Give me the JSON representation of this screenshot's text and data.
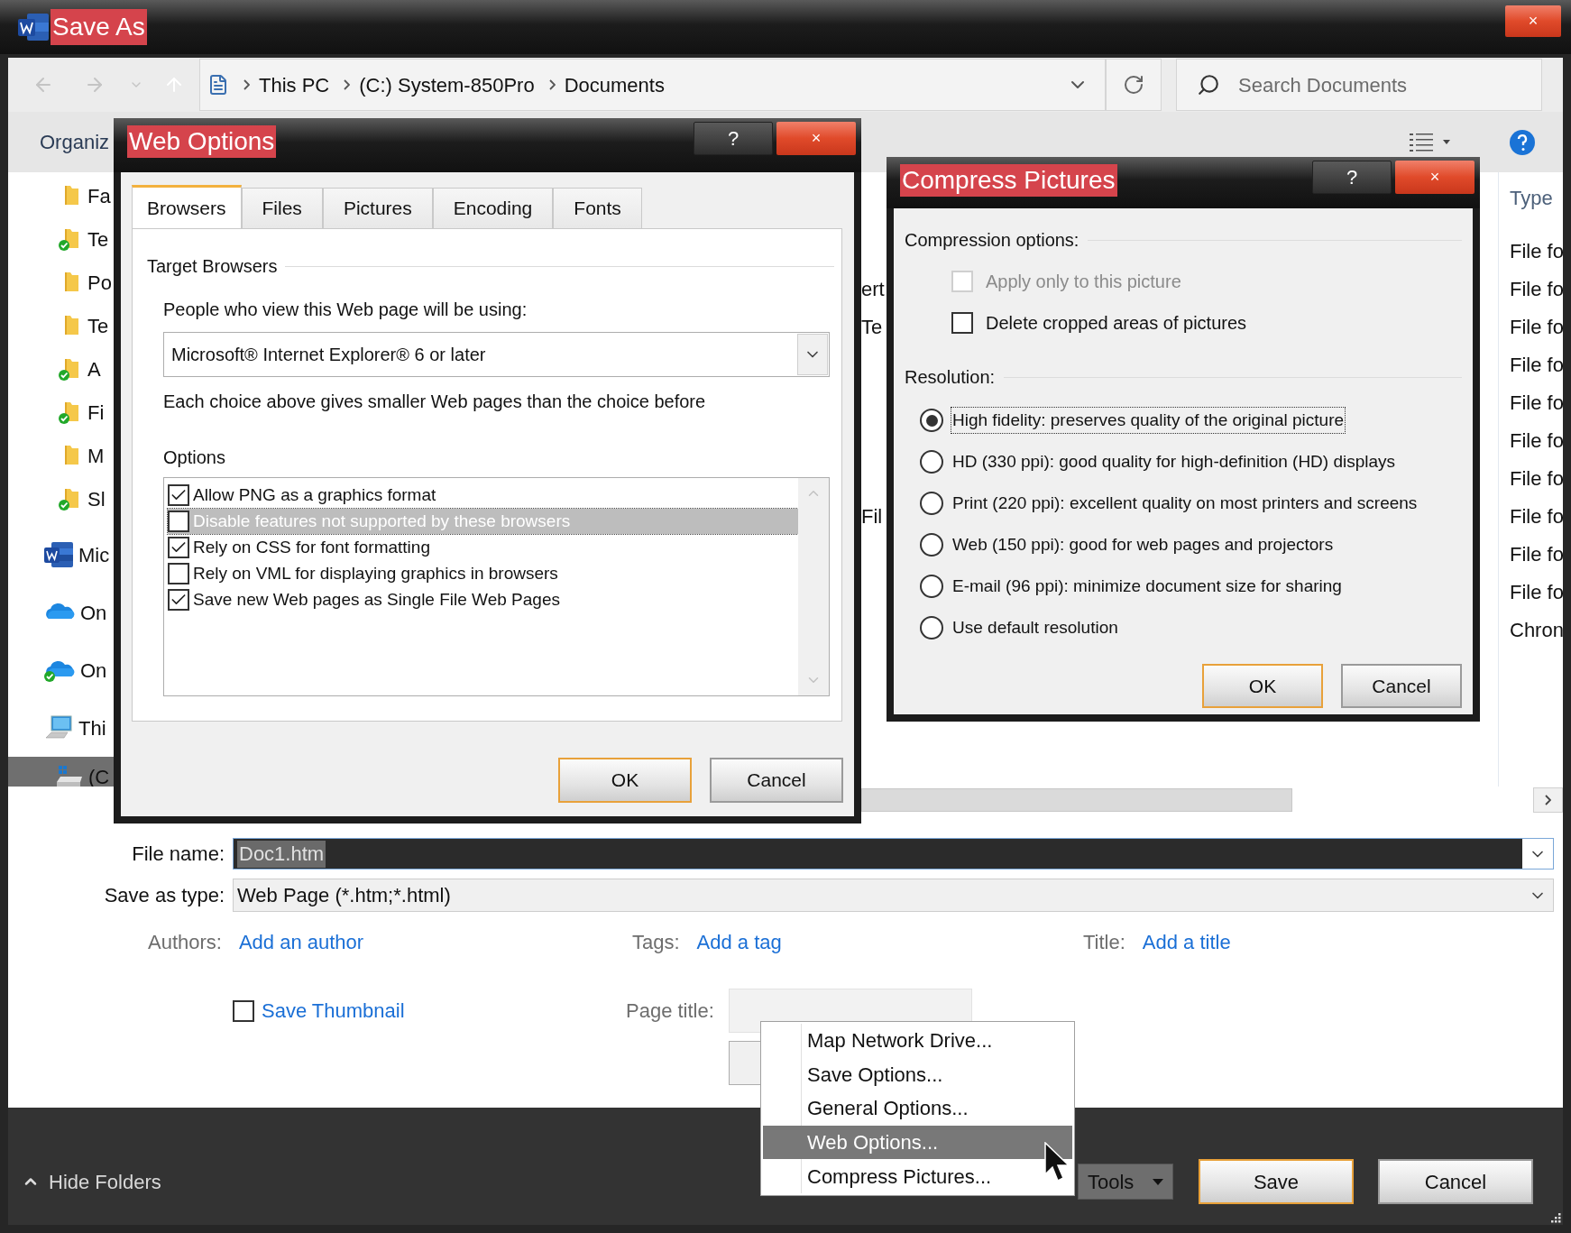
{
  "window": {
    "title": "Save As",
    "close": "×"
  },
  "address_bar": {
    "path": [
      "This PC",
      "(C:) System-850Pro",
      "Documents"
    ]
  },
  "search": {
    "placeholder": "Search Documents"
  },
  "toolbar": {
    "organize": "Organiz"
  },
  "sidebar": {
    "items": [
      {
        "label": "Fa",
        "kind": "folder",
        "selected": false
      },
      {
        "label": "Te",
        "kind": "synced-folder",
        "selected": false
      },
      {
        "label": "Po",
        "kind": "folder",
        "selected": false
      },
      {
        "label": "Te",
        "kind": "folder",
        "selected": false
      },
      {
        "label": "A",
        "kind": "synced-folder",
        "selected": false
      },
      {
        "label": "Fi",
        "kind": "synced-folder",
        "selected": false
      },
      {
        "label": "M",
        "kind": "folder",
        "selected": false
      },
      {
        "label": "Sl",
        "kind": "synced-folder",
        "selected": false
      },
      {
        "label": "Mic",
        "kind": "word",
        "selected": false
      },
      {
        "label": "On",
        "kind": "cloud",
        "selected": false
      },
      {
        "label": "On",
        "kind": "synced-cloud",
        "selected": false
      },
      {
        "label": "Thi",
        "kind": "pc",
        "selected": false,
        "children": [
          {
            "label": "(C",
            "kind": "drive",
            "selected": true
          }
        ]
      }
    ]
  },
  "file_list": {
    "columns": [
      "Type"
    ],
    "rows": [
      {
        "type": "File fo"
      },
      {
        "name": "ert",
        "type": "File fo"
      },
      {
        "name": "Te",
        "type": "File fo"
      },
      {
        "type": "File fo"
      },
      {
        "type": "File fo"
      },
      {
        "type": "File fo"
      },
      {
        "type": "File fo"
      },
      {
        "name": "Fil",
        "type": "File fo"
      },
      {
        "type": "File fo"
      },
      {
        "type": "File fo"
      },
      {
        "type": "Chron"
      }
    ]
  },
  "file_name": {
    "label": "File name:",
    "value": "Doc1.htm"
  },
  "save_as_type": {
    "label": "Save as type:",
    "value": "Web Page (*.htm;*.html)"
  },
  "properties": [
    {
      "label": "Authors:",
      "link": "Add an author"
    },
    {
      "label": "Tags:",
      "link": "Add a tag"
    },
    {
      "label": "Title:",
      "link": "Add a title"
    }
  ],
  "save_thumbnail": {
    "label": "Save Thumbnail",
    "checked": false
  },
  "page_title": {
    "label": "Page title:"
  },
  "hide_folders": "Hide Folders",
  "tools": "Tools",
  "buttons": [
    {
      "label": "Save",
      "default": true
    },
    {
      "label": "Cancel",
      "default": false
    }
  ],
  "web_options": {
    "title": "Web Options",
    "help": "?",
    "close": "×",
    "tabs": [
      {
        "label": "Browsers",
        "selected": true
      },
      {
        "label": "Files",
        "selected": false
      },
      {
        "label": "Pictures",
        "selected": false
      },
      {
        "label": "Encoding",
        "selected": false
      },
      {
        "label": "Fonts",
        "selected": false
      }
    ],
    "group": "Target Browsers",
    "prompt": "People who view this Web page will be using:",
    "browser": "Microsoft® Internet Explorer® 6 or later",
    "note": "Each choice above gives smaller Web pages than the choice before",
    "options_label": "Options",
    "options": [
      {
        "label": "Allow PNG as a graphics format",
        "checked": true,
        "selected": false
      },
      {
        "label": "Disable features not supported by these browsers",
        "checked": false,
        "selected": true
      },
      {
        "label": "Rely on CSS for font formatting",
        "checked": true,
        "selected": false
      },
      {
        "label": "Rely on VML for displaying graphics in browsers",
        "checked": false,
        "selected": false
      },
      {
        "label": "Save new Web pages as Single File Web Pages",
        "checked": true,
        "selected": false
      }
    ],
    "buttons": [
      {
        "label": "OK",
        "default": true
      },
      {
        "label": "Cancel",
        "default": false
      }
    ]
  },
  "compress_pictures": {
    "title": "Compress Pictures",
    "help": "?",
    "close": "×",
    "compression_label": "Compression options:",
    "checkboxes": [
      {
        "label": "Apply only to this picture",
        "checked": false,
        "disabled": true
      },
      {
        "label": "Delete cropped areas of pictures",
        "checked": false,
        "disabled": false
      }
    ],
    "resolution_label": "Resolution:",
    "resolutions": [
      {
        "label": "High fidelity: preserves quality of the original picture",
        "selected": true
      },
      {
        "label": "HD (330 ppi): good quality for high-definition (HD) displays",
        "selected": false
      },
      {
        "label": "Print (220 ppi): excellent quality on most printers and screens",
        "selected": false
      },
      {
        "label": "Web (150 ppi): good for web pages and projectors",
        "selected": false
      },
      {
        "label": "E-mail (96 ppi): minimize document size for sharing",
        "selected": false
      },
      {
        "label": "Use default resolution",
        "selected": false
      }
    ],
    "buttons": [
      {
        "label": "OK",
        "default": true
      },
      {
        "label": "Cancel",
        "default": false
      }
    ]
  },
  "context_menu": {
    "items": [
      {
        "label": "Map Network Drive...",
        "selected": false
      },
      {
        "label": "Save Options...",
        "selected": false
      },
      {
        "label": "General Options...",
        "selected": false
      },
      {
        "label": "Web Options...",
        "selected": true
      },
      {
        "label": "Compress Pictures...",
        "selected": false
      }
    ]
  }
}
